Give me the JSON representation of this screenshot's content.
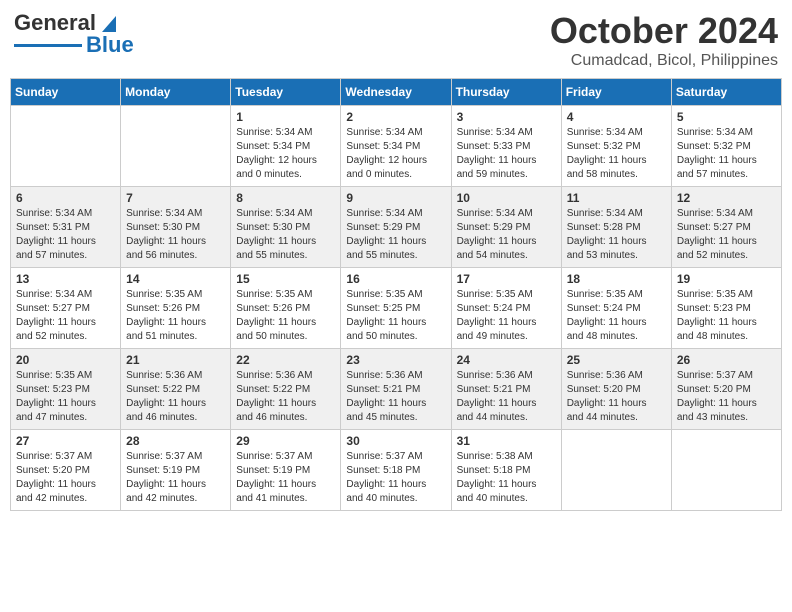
{
  "header": {
    "logo_line1": "General",
    "logo_line2": "Blue",
    "title": "October 2024",
    "subtitle": "Cumadcad, Bicol, Philippines"
  },
  "days_of_week": [
    "Sunday",
    "Monday",
    "Tuesday",
    "Wednesday",
    "Thursday",
    "Friday",
    "Saturday"
  ],
  "weeks": [
    [
      {
        "day": "",
        "info": ""
      },
      {
        "day": "",
        "info": ""
      },
      {
        "day": "1",
        "info": "Sunrise: 5:34 AM\nSunset: 5:34 PM\nDaylight: 12 hours\nand 0 minutes."
      },
      {
        "day": "2",
        "info": "Sunrise: 5:34 AM\nSunset: 5:34 PM\nDaylight: 12 hours\nand 0 minutes."
      },
      {
        "day": "3",
        "info": "Sunrise: 5:34 AM\nSunset: 5:33 PM\nDaylight: 11 hours\nand 59 minutes."
      },
      {
        "day": "4",
        "info": "Sunrise: 5:34 AM\nSunset: 5:32 PM\nDaylight: 11 hours\nand 58 minutes."
      },
      {
        "day": "5",
        "info": "Sunrise: 5:34 AM\nSunset: 5:32 PM\nDaylight: 11 hours\nand 57 minutes."
      }
    ],
    [
      {
        "day": "6",
        "info": "Sunrise: 5:34 AM\nSunset: 5:31 PM\nDaylight: 11 hours\nand 57 minutes."
      },
      {
        "day": "7",
        "info": "Sunrise: 5:34 AM\nSunset: 5:30 PM\nDaylight: 11 hours\nand 56 minutes."
      },
      {
        "day": "8",
        "info": "Sunrise: 5:34 AM\nSunset: 5:30 PM\nDaylight: 11 hours\nand 55 minutes."
      },
      {
        "day": "9",
        "info": "Sunrise: 5:34 AM\nSunset: 5:29 PM\nDaylight: 11 hours\nand 55 minutes."
      },
      {
        "day": "10",
        "info": "Sunrise: 5:34 AM\nSunset: 5:29 PM\nDaylight: 11 hours\nand 54 minutes."
      },
      {
        "day": "11",
        "info": "Sunrise: 5:34 AM\nSunset: 5:28 PM\nDaylight: 11 hours\nand 53 minutes."
      },
      {
        "day": "12",
        "info": "Sunrise: 5:34 AM\nSunset: 5:27 PM\nDaylight: 11 hours\nand 52 minutes."
      }
    ],
    [
      {
        "day": "13",
        "info": "Sunrise: 5:34 AM\nSunset: 5:27 PM\nDaylight: 11 hours\nand 52 minutes."
      },
      {
        "day": "14",
        "info": "Sunrise: 5:35 AM\nSunset: 5:26 PM\nDaylight: 11 hours\nand 51 minutes."
      },
      {
        "day": "15",
        "info": "Sunrise: 5:35 AM\nSunset: 5:26 PM\nDaylight: 11 hours\nand 50 minutes."
      },
      {
        "day": "16",
        "info": "Sunrise: 5:35 AM\nSunset: 5:25 PM\nDaylight: 11 hours\nand 50 minutes."
      },
      {
        "day": "17",
        "info": "Sunrise: 5:35 AM\nSunset: 5:24 PM\nDaylight: 11 hours\nand 49 minutes."
      },
      {
        "day": "18",
        "info": "Sunrise: 5:35 AM\nSunset: 5:24 PM\nDaylight: 11 hours\nand 48 minutes."
      },
      {
        "day": "19",
        "info": "Sunrise: 5:35 AM\nSunset: 5:23 PM\nDaylight: 11 hours\nand 48 minutes."
      }
    ],
    [
      {
        "day": "20",
        "info": "Sunrise: 5:35 AM\nSunset: 5:23 PM\nDaylight: 11 hours\nand 47 minutes."
      },
      {
        "day": "21",
        "info": "Sunrise: 5:36 AM\nSunset: 5:22 PM\nDaylight: 11 hours\nand 46 minutes."
      },
      {
        "day": "22",
        "info": "Sunrise: 5:36 AM\nSunset: 5:22 PM\nDaylight: 11 hours\nand 46 minutes."
      },
      {
        "day": "23",
        "info": "Sunrise: 5:36 AM\nSunset: 5:21 PM\nDaylight: 11 hours\nand 45 minutes."
      },
      {
        "day": "24",
        "info": "Sunrise: 5:36 AM\nSunset: 5:21 PM\nDaylight: 11 hours\nand 44 minutes."
      },
      {
        "day": "25",
        "info": "Sunrise: 5:36 AM\nSunset: 5:20 PM\nDaylight: 11 hours\nand 44 minutes."
      },
      {
        "day": "26",
        "info": "Sunrise: 5:37 AM\nSunset: 5:20 PM\nDaylight: 11 hours\nand 43 minutes."
      }
    ],
    [
      {
        "day": "27",
        "info": "Sunrise: 5:37 AM\nSunset: 5:20 PM\nDaylight: 11 hours\nand 42 minutes."
      },
      {
        "day": "28",
        "info": "Sunrise: 5:37 AM\nSunset: 5:19 PM\nDaylight: 11 hours\nand 42 minutes."
      },
      {
        "day": "29",
        "info": "Sunrise: 5:37 AM\nSunset: 5:19 PM\nDaylight: 11 hours\nand 41 minutes."
      },
      {
        "day": "30",
        "info": "Sunrise: 5:37 AM\nSunset: 5:18 PM\nDaylight: 11 hours\nand 40 minutes."
      },
      {
        "day": "31",
        "info": "Sunrise: 5:38 AM\nSunset: 5:18 PM\nDaylight: 11 hours\nand 40 minutes."
      },
      {
        "day": "",
        "info": ""
      },
      {
        "day": "",
        "info": ""
      }
    ]
  ]
}
